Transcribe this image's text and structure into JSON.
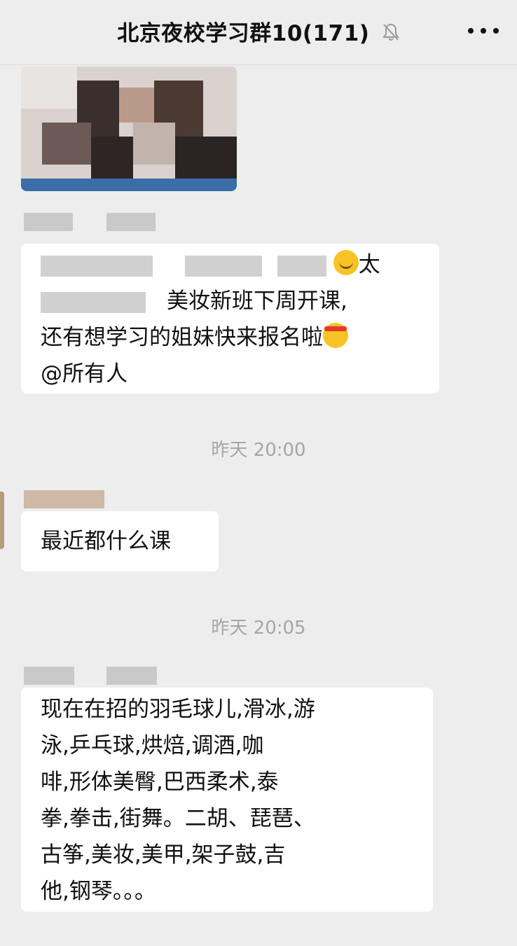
{
  "header": {
    "title": "北京夜校学习群10(171)",
    "more_icon": "more-dots-icon",
    "mute_icon": "bell-off-icon"
  },
  "messages": {
    "m1_photo": {
      "icon": "image-thumbnail"
    },
    "m2": {
      "line1_visible": "太",
      "line2_visible": "美妆新班下周开课,",
      "line3": "还有想学习的姐妹快来报名啦",
      "line4": "@所有人"
    },
    "time1": "昨天 20:00",
    "m3": {
      "text": "最近都什么课"
    },
    "time2": "昨天 20:05",
    "m4": {
      "lines": [
        "现在在招的羽毛球儿,滑冰,游",
        "泳,乒乓球,烘焙,调酒,咖",
        "啡,形体美臀,巴西柔术,泰",
        "拳,拳击,街舞。二胡、琵琶、",
        "古筝,美妆,美甲,架子鼓,吉",
        "他,钢琴。。。"
      ]
    }
  },
  "colors": {
    "background": "#ededed",
    "bubble": "#ffffff",
    "timestamp": "#a6a6a6"
  }
}
